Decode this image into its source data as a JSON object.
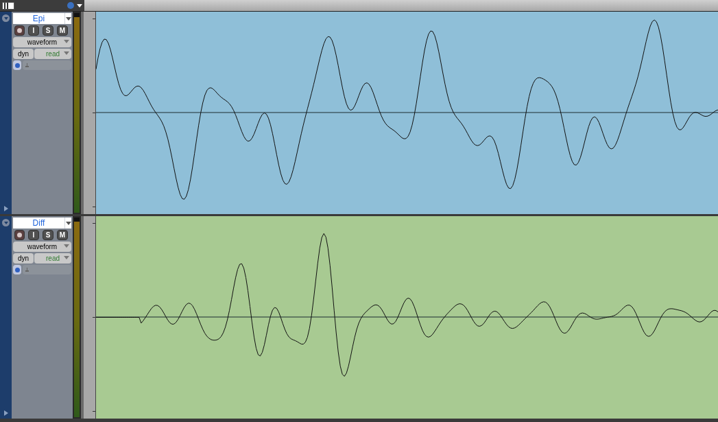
{
  "tracks": [
    {
      "name": "Epi",
      "color": "#8fbfd8",
      "view": "waveform",
      "buttons": [
        "I",
        "S",
        "M"
      ],
      "automation": "dyn",
      "mode": "read"
    },
    {
      "name": "Diff",
      "color": "#a8ca92",
      "view": "waveform",
      "buttons": [
        "I",
        "S",
        "M"
      ],
      "automation": "dyn",
      "mode": "read"
    }
  ]
}
